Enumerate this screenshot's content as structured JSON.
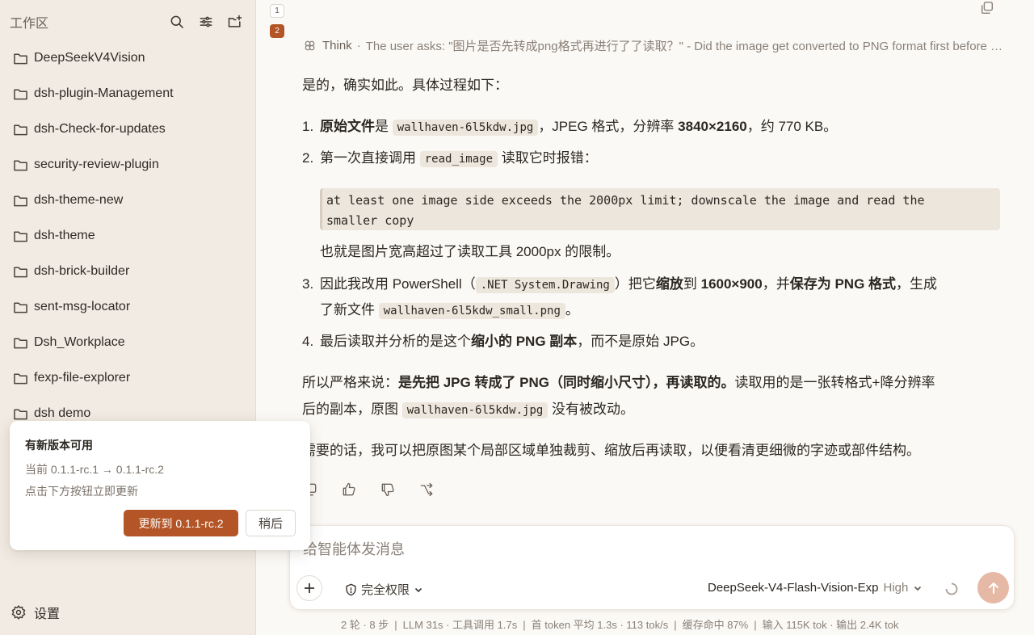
{
  "sidebar": {
    "title": "工作区",
    "folders": [
      {
        "label": "DeepSeekV4Vision"
      },
      {
        "label": "dsh-plugin-Management"
      },
      {
        "label": "dsh-Check-for-updates"
      },
      {
        "label": "security-review-plugin"
      },
      {
        "label": "dsh-theme-new"
      },
      {
        "label": "dsh-theme"
      },
      {
        "label": "dsh-brick-builder"
      },
      {
        "label": "sent-msg-locator"
      },
      {
        "label": "Dsh_Workplace"
      },
      {
        "label": "fexp-file-explorer"
      },
      {
        "label": "dsh demo"
      }
    ],
    "settings_label": "设置"
  },
  "update_popup": {
    "title": "有新版本可用",
    "version_line": "当前 0.1.1-rc.1 → 0.1.1-rc.2",
    "hint": "点击下方按钮立即更新",
    "update_button": "更新到 0.1.1-rc.2",
    "later_button": "稍后"
  },
  "pager": {
    "pages": [
      "1",
      "2"
    ],
    "active": "2"
  },
  "thinking": {
    "label": "Think",
    "dot": "·",
    "text": "The user asks: \"图片是否先转成png格式再进行了了读取？\" - Did the image get converted to PNG format first before being read?"
  },
  "answer": {
    "intro": "是的，确实如此。具体过程如下：",
    "item1": {
      "num": "1.",
      "bold": "原始文件",
      "a": "是",
      "code": "wallhaven-6l5kdw.jpg",
      "b": "，JPEG 格式，分辨率 ",
      "bold2": "3840×2160",
      "c": "，约 770 KB。"
    },
    "item2": {
      "num": "2.",
      "a": "第一次直接调用",
      "code": "read_image",
      "b": "读取它时报错："
    },
    "quote_line1": "at least one image side exceeds the 2000px limit; downscale the image and read the",
    "quote_line2": "smaller copy",
    "item2_note": "也就是图片宽高超过了读取工具 2000px 的限制。",
    "item3": {
      "num": "3.",
      "a": "因此我改用 PowerShell（",
      "code": ".NET System.Drawing",
      "b": "）把它",
      "bold1": "缩放",
      "c": "到 ",
      "bold2": "1600×900",
      "d": "，并",
      "bold3": "保存为 PNG 格式",
      "e": "，生成",
      "f": "了新文件",
      "code2": "wallhaven-6l5kdw_small.png",
      "g": "。"
    },
    "item4": {
      "num": "4.",
      "a": "最后读取并分析的是这个",
      "bold": "缩小的 PNG 副本",
      "b": "，而不是原始 JPG。"
    },
    "summary": {
      "a": "所以严格来说：",
      "bold": "是先把 JPG 转成了 PNG（同时缩小尺寸），再读取的。",
      "b": "读取用的是一张转格式+降分辨率",
      "c": "后的副本，原图",
      "code": "wallhaven-6l5kdw.jpg",
      "d": "没有被改动。"
    },
    "closing": "需要的话，我可以把原图某个局部区域单独裁剪、缩放后再读取，以便看清更细微的字迹或部件结构。"
  },
  "composer": {
    "placeholder": "给智能体发消息",
    "permission": "完全权限",
    "model": "DeepSeek-V4-Flash-Vision-Exp",
    "level": "High"
  },
  "status": {
    "rounds": "2 轮 · 8 步",
    "llm": "LLM 31s · 工具调用 1.7s",
    "first_token": "首 token 平均 1.3s · 113 tok/s",
    "cache": "缓存命中 87%",
    "tokens": "输入 115K tok · 输出 2.4K tok"
  }
}
